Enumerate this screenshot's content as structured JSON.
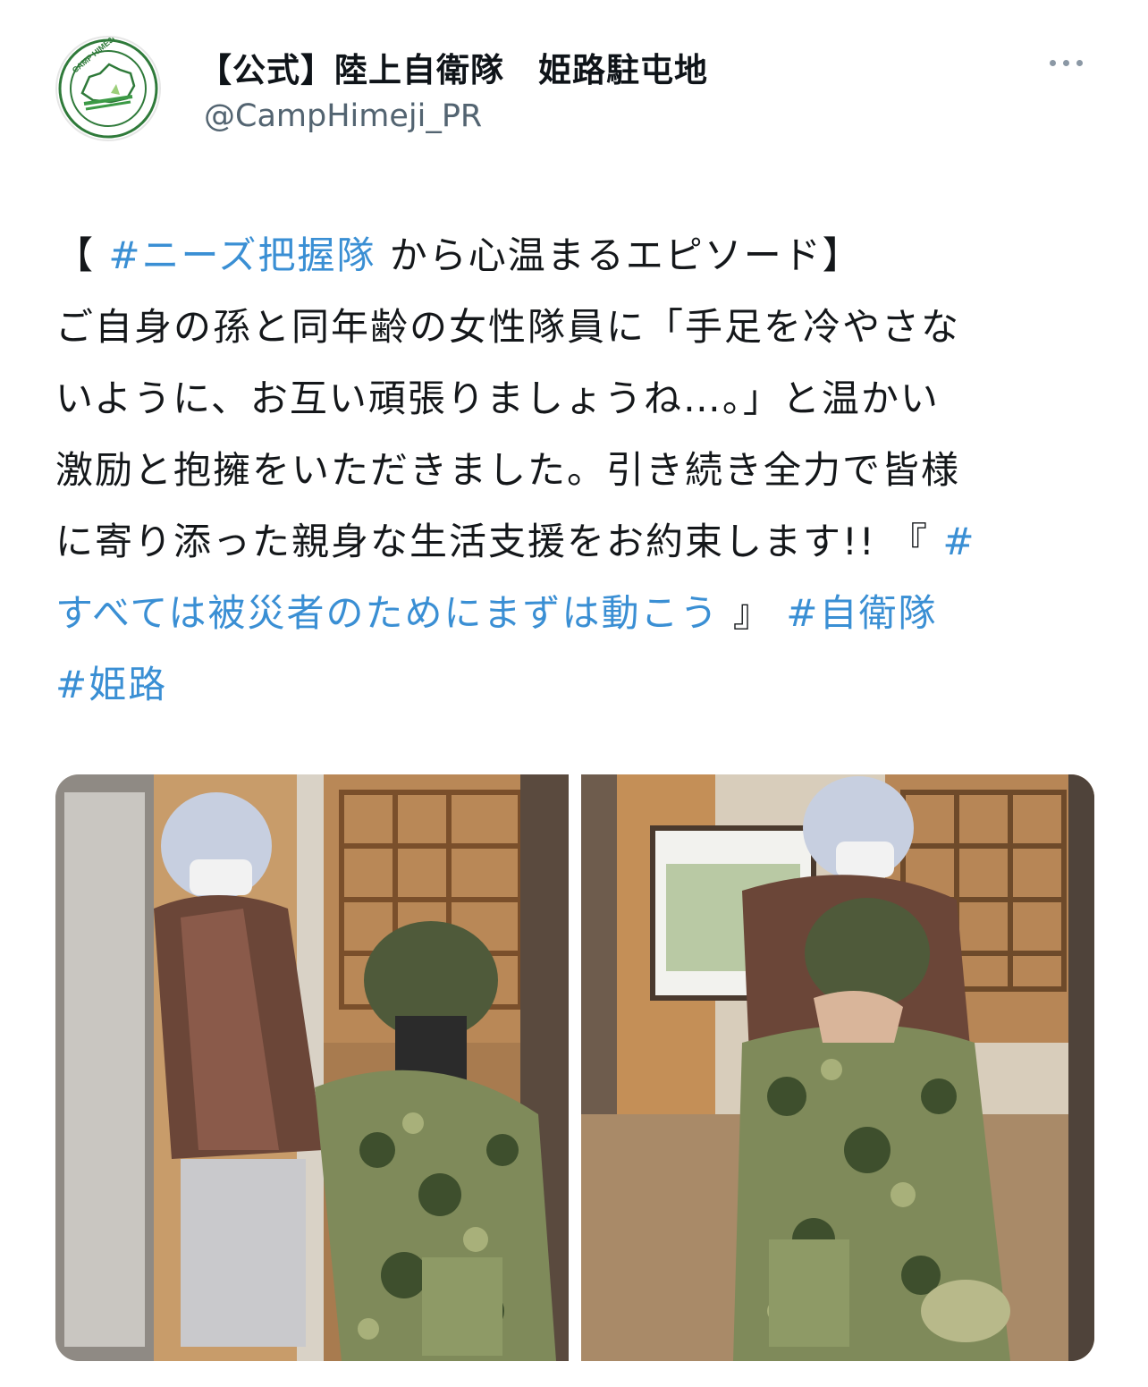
{
  "author": {
    "display_name": "【公式】陸上自衛隊　姫路駐屯地",
    "handle": "@CampHimeji_PR",
    "avatar_icon": "camp-himeji-emblem-icon",
    "avatar_text": "CAMP HIMEJI"
  },
  "more_icon": "more-horizontal-icon",
  "tweet": {
    "lines": [
      [
        {
          "text": "【 ",
          "tag": false
        },
        {
          "text": "#ニーズ把握隊",
          "tag": true
        },
        {
          "text": " から心温まるエピソード】",
          "tag": false
        }
      ],
      [
        {
          "text": "ご自身の孫と同年齢の女性隊員に「手足を冷やさな",
          "tag": false
        }
      ],
      [
        {
          "text": "いように、お互い頑張りましょうね…。」と温かい",
          "tag": false
        }
      ],
      [
        {
          "text": "激励と抱擁をいただきました。引き続き全力で皆様",
          "tag": false
        }
      ],
      [
        {
          "text": "に寄り添った親身な生活支援をお約束します!! 『 ",
          "tag": false
        },
        {
          "text": "#",
          "tag": true
        }
      ],
      [
        {
          "text": "すべては被災者のためにまずは動こう",
          "tag": true
        },
        {
          "text": " 』 ",
          "tag": false
        },
        {
          "text": "#自衛隊",
          "tag": true
        }
      ],
      [
        {
          "text": "#姫路",
          "tag": true
        }
      ]
    ]
  },
  "media": [
    {
      "name": "photo-handshake",
      "icon": "photo-handshake-image"
    },
    {
      "name": "photo-hug",
      "icon": "photo-hug-image"
    }
  ],
  "colors": {
    "hashtag": "#3a8fd4",
    "handle": "#536471",
    "text": "#14171a"
  }
}
